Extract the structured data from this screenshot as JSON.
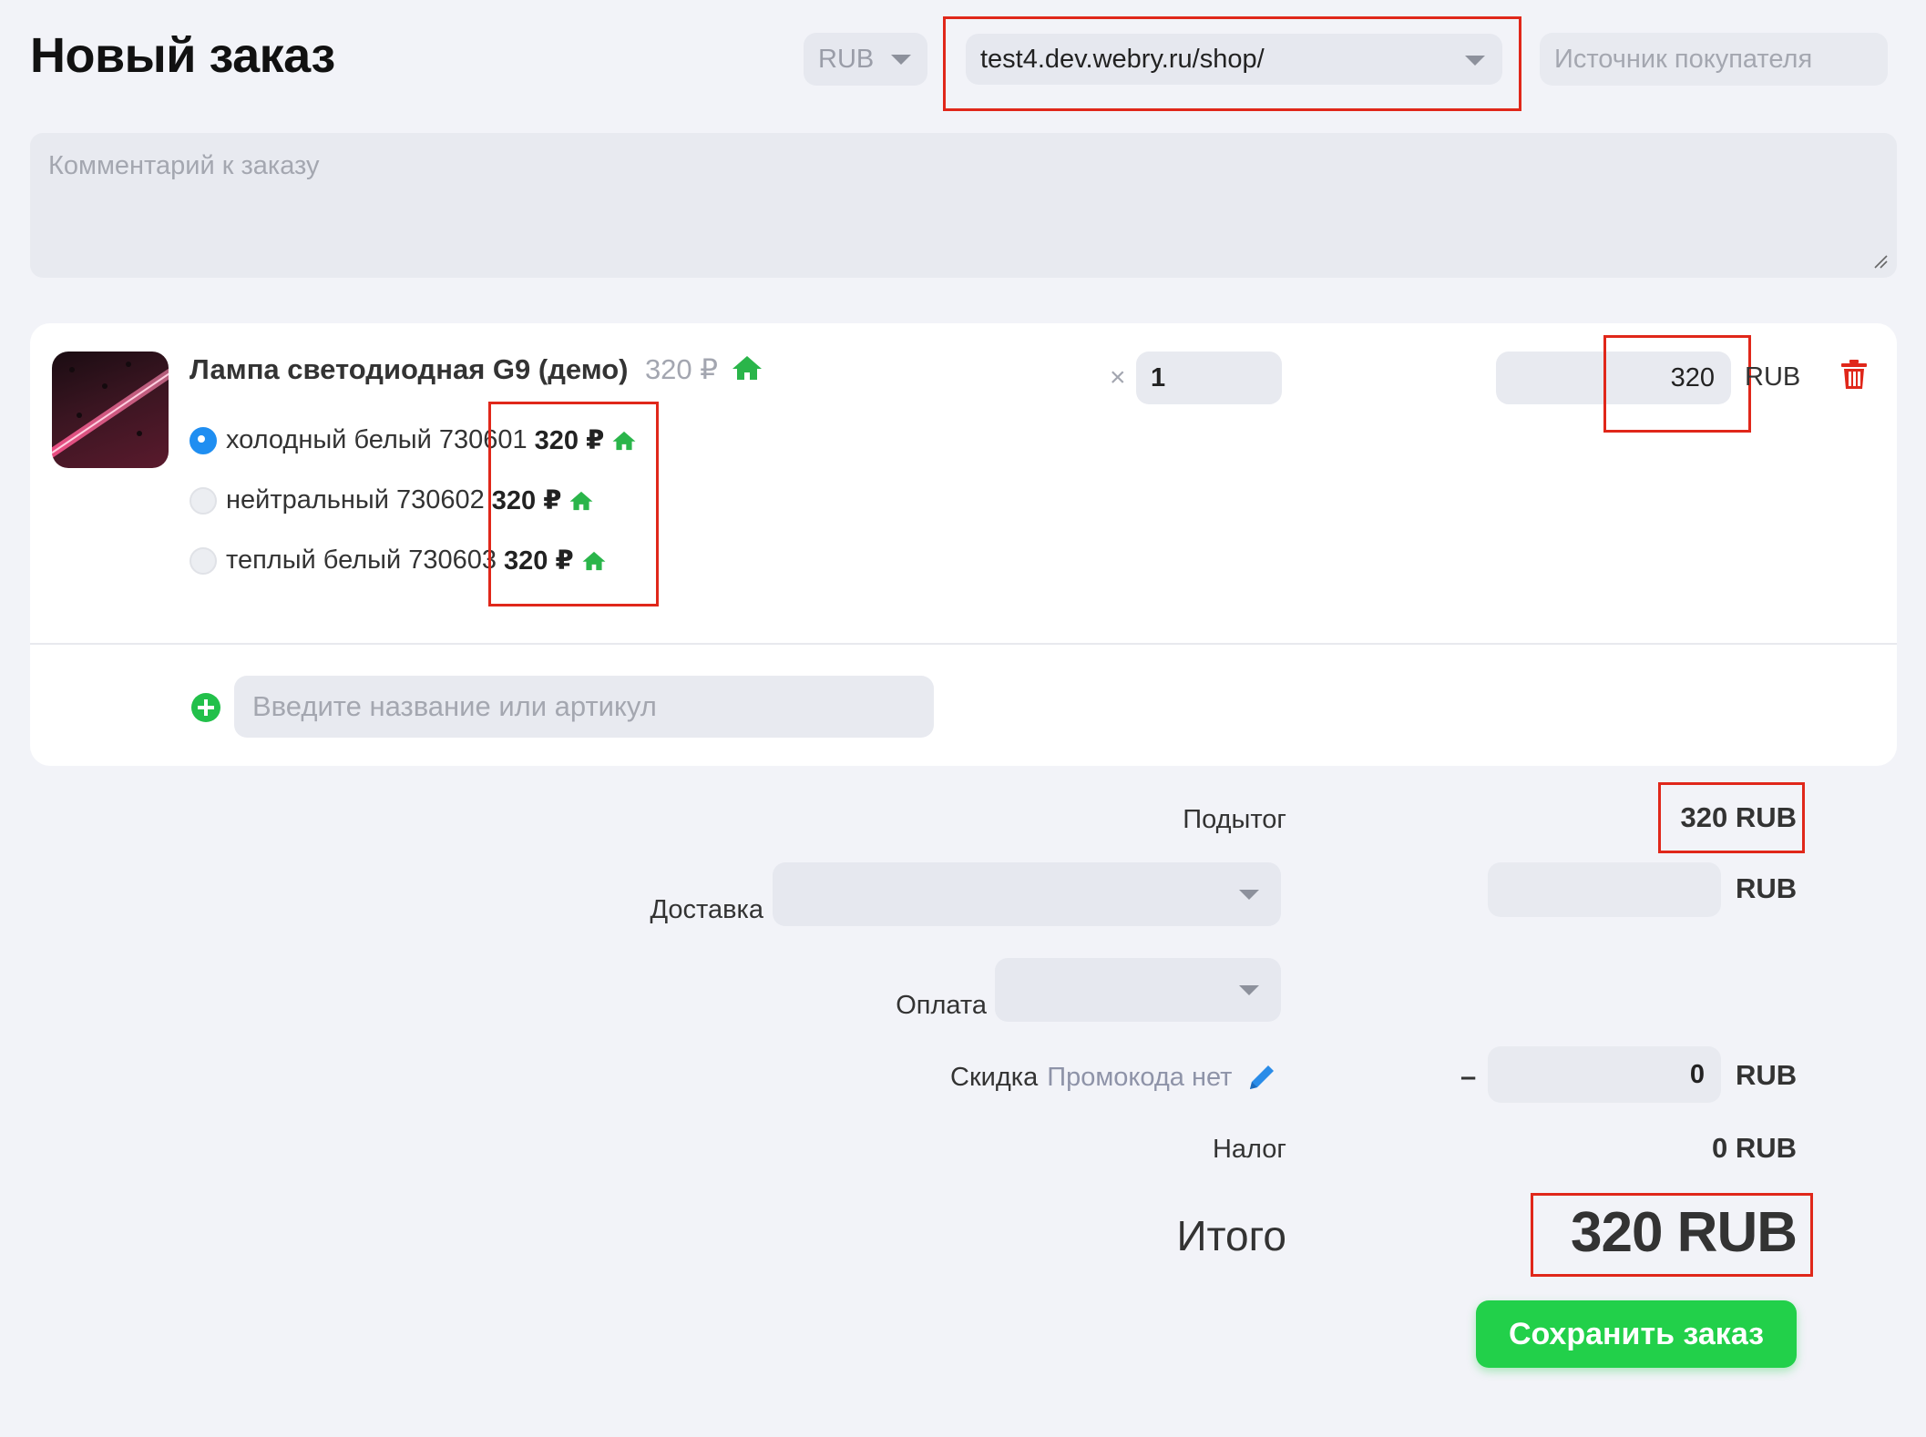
{
  "header": {
    "title": "Новый заказ",
    "currency_select": "RUB",
    "storefront_select": "test4.dev.webry.ru/shop/",
    "source_placeholder": "Источник покупателя"
  },
  "comment": {
    "placeholder": "Комментарий к заказу"
  },
  "product": {
    "name": "Лампа светодиодная G9 (демо)",
    "price": "320 ₽",
    "quantity_prefix": "×",
    "quantity": "1",
    "line_total": "320",
    "currency": "RUB",
    "variants": [
      {
        "name": "холодный белый",
        "sku": "730601",
        "price": "320 ₽",
        "selected": true
      },
      {
        "name": "нейтральный",
        "sku": "730602",
        "price": "320 ₽",
        "selected": false
      },
      {
        "name": "теплый белый",
        "sku": "730603",
        "price": "320 ₽",
        "selected": false
      }
    ]
  },
  "add_product": {
    "placeholder": "Введите название или артикул"
  },
  "summary": {
    "subtotal_label": "Подытог",
    "subtotal_value": "320 RUB",
    "shipping_label": "Доставка",
    "shipping_currency": "RUB",
    "payment_label": "Оплата",
    "discount_label": "Скидка",
    "promo_text": "Промокода нет",
    "discount_sign": "–",
    "discount_value": "0",
    "discount_currency": "RUB",
    "tax_label": "Налог",
    "tax_value": "0 RUB",
    "total_label": "Итого",
    "total_value": "320 RUB"
  },
  "actions": {
    "save_label": "Сохранить заказ"
  },
  "colors": {
    "accent_green": "#22d04a",
    "highlight_red": "#e0271a",
    "radio_blue": "#1f8ef1",
    "delete_red": "#e0271a"
  }
}
